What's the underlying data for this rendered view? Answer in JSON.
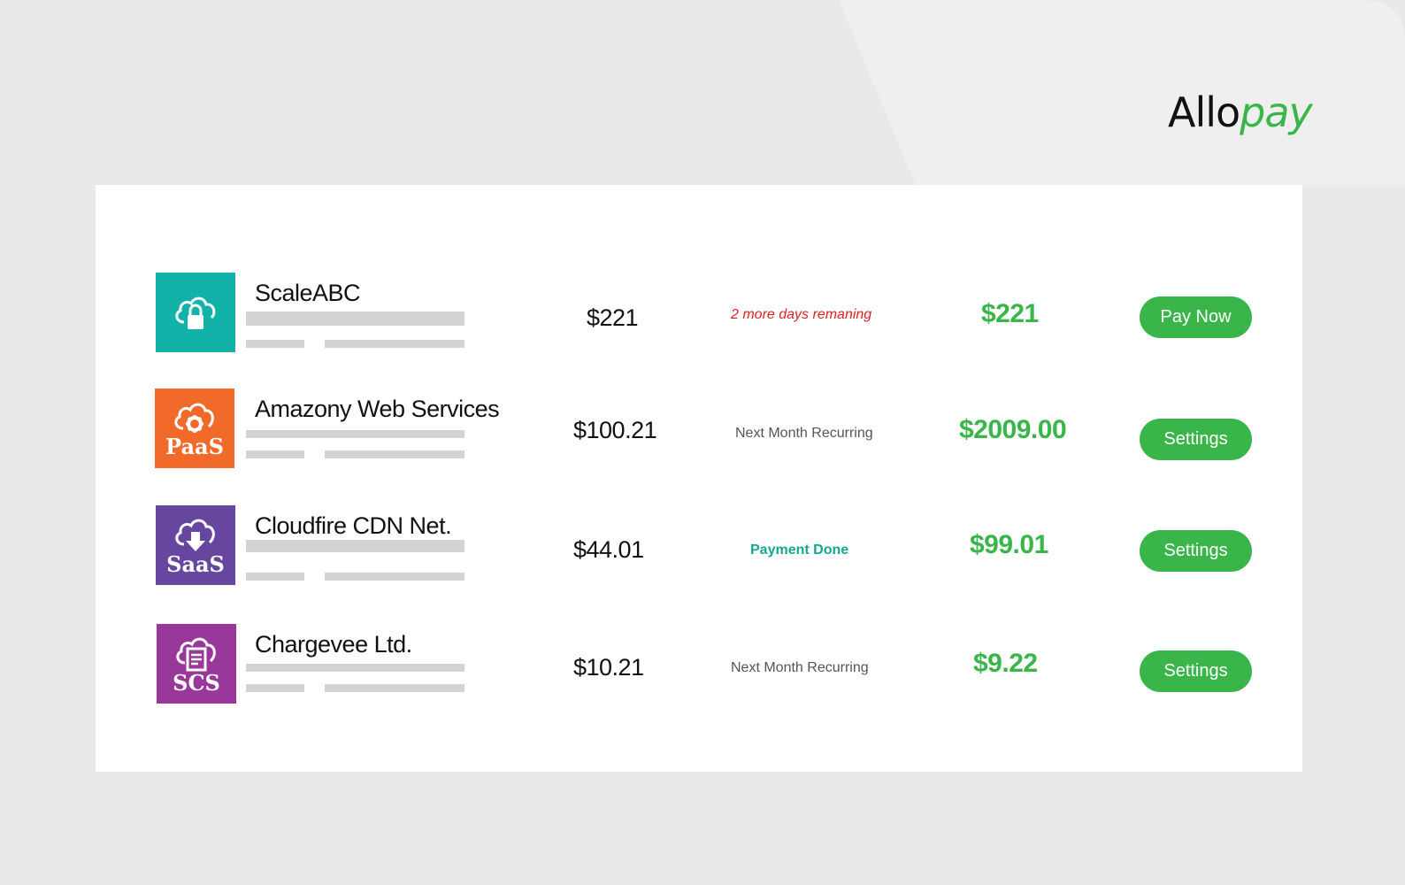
{
  "brand": {
    "logo_part1": "Allo",
    "logo_part2": "pay"
  },
  "colors": {
    "accent": "#3ab54a",
    "warning": "#e02020",
    "success_text": "#16a594"
  },
  "services": [
    {
      "name": "ScaleABC",
      "icon": "cloud-lock-icon",
      "icon_color": "#12b2a8",
      "icon_label": "",
      "amount": "$221",
      "status": "2 more days remaning",
      "status_type": "warn",
      "total": "$221",
      "action": "Pay Now"
    },
    {
      "name": "Amazony Web Services",
      "icon": "cloud-gear-icon",
      "icon_color": "#f26a2a",
      "icon_label": "PaaS",
      "amount": "$100.21",
      "status": "Next Month Recurring",
      "status_type": "info",
      "total": "$2009.00",
      "action": "Settings"
    },
    {
      "name": "Cloudfire CDN Net.",
      "icon": "cloud-download-icon",
      "icon_color": "#6746a0",
      "icon_label": "SaaS",
      "amount": "$44.01",
      "status": "Payment Done",
      "status_type": "ok",
      "total": "$99.01",
      "action": "Settings"
    },
    {
      "name": "Chargevee Ltd.",
      "icon": "cloud-document-icon",
      "icon_color": "#99379a",
      "icon_label": "SCS",
      "amount": "$10.21",
      "status": "Next Month Recurring",
      "status_type": "info",
      "total": "$9.22",
      "action": "Settings"
    }
  ]
}
